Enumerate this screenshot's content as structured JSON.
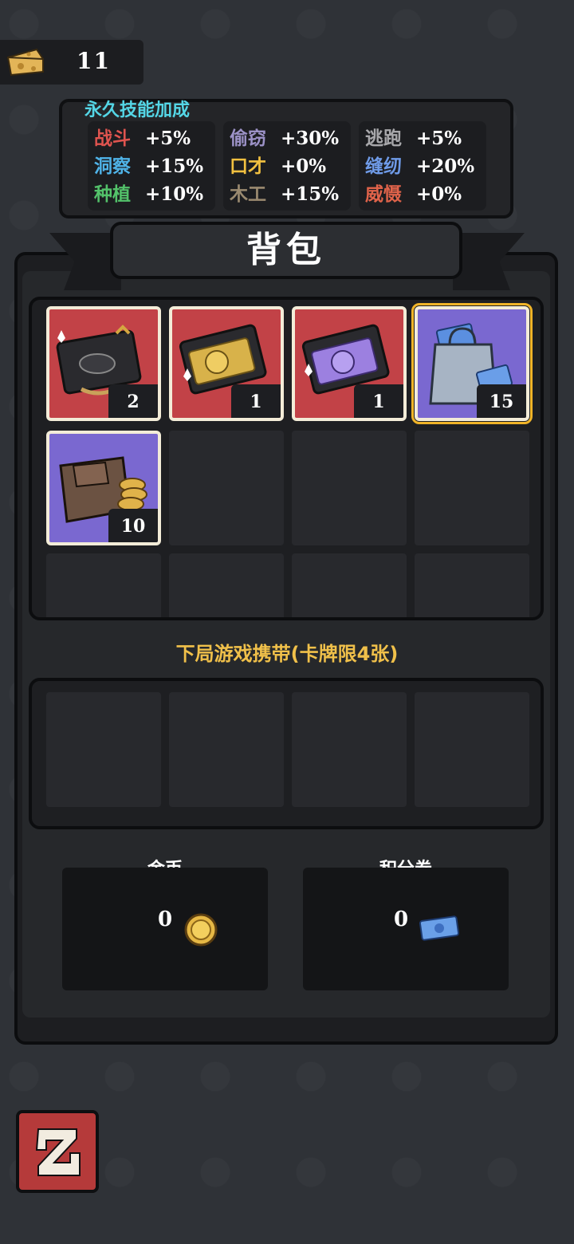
{
  "cheese": {
    "count": "11"
  },
  "skills": {
    "title": "永久技能加成",
    "columns": [
      [
        {
          "name": "战斗",
          "value": "+5%",
          "color": "#e0544f"
        },
        {
          "name": "洞察",
          "value": "+15%",
          "color": "#4fb3e8"
        },
        {
          "name": "种植",
          "value": "+10%",
          "color": "#53c26a"
        }
      ],
      [
        {
          "name": "偷窃",
          "value": "+30%",
          "color": "#9c92c7"
        },
        {
          "name": "口才",
          "value": "+0%",
          "color": "#f1c040"
        },
        {
          "name": "木工",
          "value": "+15%",
          "color": "#9a8a70"
        }
      ],
      [
        {
          "name": "逃跑",
          "value": "+5%",
          "color": "#a8a8ab"
        },
        {
          "name": "缝纫",
          "value": "+20%",
          "color": "#6f9be8"
        },
        {
          "name": "威慑",
          "value": "+0%",
          "color": "#e0634a"
        }
      ]
    ]
  },
  "backpack": {
    "title": "背包",
    "items": [
      {
        "icon": "black-card-box-icon",
        "count": "2",
        "bg": "red",
        "selected": false
      },
      {
        "icon": "gold-card-box-icon",
        "count": "1",
        "bg": "red",
        "selected": false
      },
      {
        "icon": "purple-card-box-icon",
        "count": "1",
        "bg": "red",
        "selected": false
      },
      {
        "icon": "ticket-bag-icon",
        "count": "15",
        "bg": "purple",
        "selected": true
      },
      {
        "icon": "coin-wallet-icon",
        "count": "10",
        "bg": "purple",
        "selected": false
      }
    ]
  },
  "carry": {
    "label": "下局游戏携带(卡牌限4张)"
  },
  "currency": {
    "gold": {
      "label": "金币",
      "value": "0",
      "icon": "gold-coin-icon"
    },
    "points": {
      "label": "积分券",
      "value": "0",
      "icon": "points-ticket-icon"
    }
  },
  "colors": {
    "accent_gold": "#f0b428",
    "skill_title": "#54d6e6",
    "back_button": "#b53a3a"
  },
  "back_button": {
    "icon": "return-arrow-icon"
  }
}
